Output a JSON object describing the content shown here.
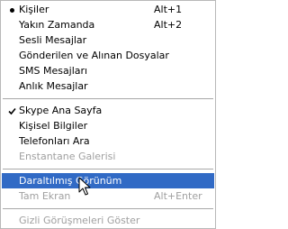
{
  "menu": {
    "items": [
      {
        "label": "Kişiler",
        "shortcut": "Alt+1",
        "mark": "bullet",
        "state": "normal"
      },
      {
        "label": "Yakın Zamanda",
        "shortcut": "Alt+2",
        "mark": "",
        "state": "normal"
      },
      {
        "label": "Sesli Mesajlar",
        "shortcut": "",
        "mark": "",
        "state": "normal"
      },
      {
        "label": "Gönderilen ve Alınan Dosyalar",
        "shortcut": "",
        "mark": "",
        "state": "normal"
      },
      {
        "label": "SMS Mesajları",
        "shortcut": "",
        "mark": "",
        "state": "normal"
      },
      {
        "label": "Anlık Mesajlar",
        "shortcut": "",
        "mark": "",
        "state": "normal"
      },
      {
        "label": "Skype Ana Sayfa",
        "shortcut": "",
        "mark": "check",
        "state": "normal"
      },
      {
        "label": "Kişisel Bilgiler",
        "shortcut": "",
        "mark": "",
        "state": "normal"
      },
      {
        "label": "Telefonları Ara",
        "shortcut": "",
        "mark": "",
        "state": "normal"
      },
      {
        "label": "Enstantane Galerisi",
        "shortcut": "",
        "mark": "",
        "state": "disabled"
      },
      {
        "label": "Daraltılmış Görünüm",
        "shortcut": "",
        "mark": "",
        "state": "highlight"
      },
      {
        "label": "Tam Ekran",
        "shortcut": "Alt+Enter",
        "mark": "",
        "state": "disabled"
      },
      {
        "label": "Gizli Görüşmeleri Göster",
        "shortcut": "",
        "mark": "",
        "state": "disabled"
      }
    ]
  },
  "colors": {
    "highlight": "#316ac5",
    "disabled_text": "#a0a0a0",
    "separator": "#a8a8a8"
  },
  "icons": {
    "bullet": "radio-bullet-icon",
    "check": "checkmark-icon",
    "cursor": "mouse-pointer-icon"
  }
}
